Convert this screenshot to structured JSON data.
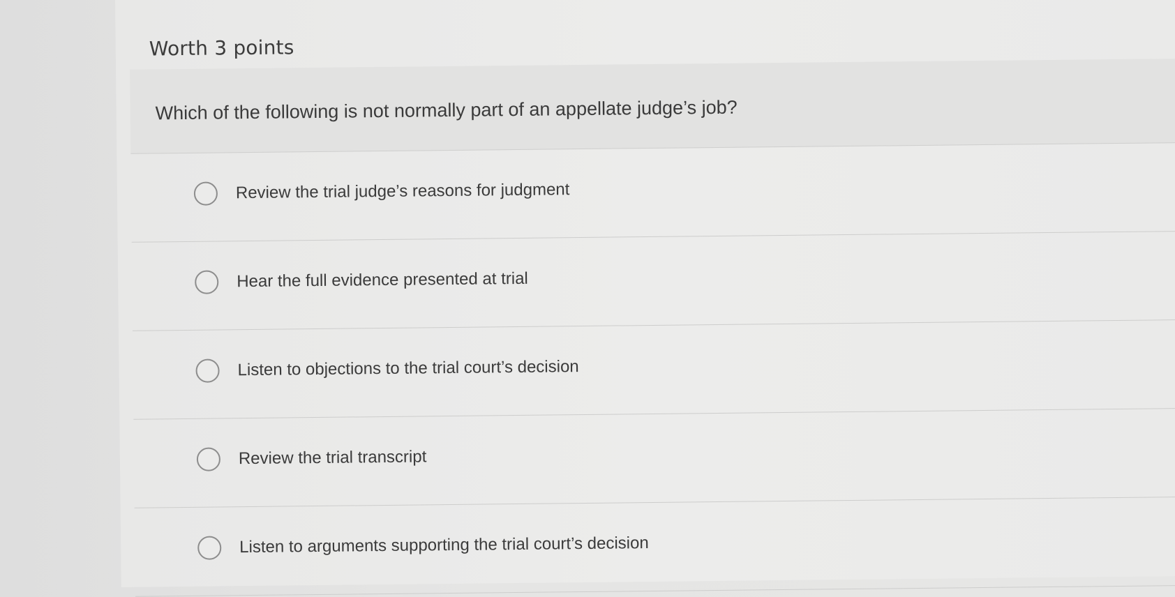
{
  "header": {
    "points_label": "Worth 3 points"
  },
  "question": {
    "text": "Which of the following is not normally part of an appellate judge’s job?"
  },
  "options": [
    {
      "label": "Review the trial judge’s reasons for judgment",
      "selected": false
    },
    {
      "label": "Hear the full evidence presented at trial",
      "selected": false
    },
    {
      "label": "Listen to objections to the trial court’s decision",
      "selected": false
    },
    {
      "label": "Review the trial transcript",
      "selected": false
    },
    {
      "label": "Listen to arguments supporting the trial court’s decision",
      "selected": false
    }
  ]
}
